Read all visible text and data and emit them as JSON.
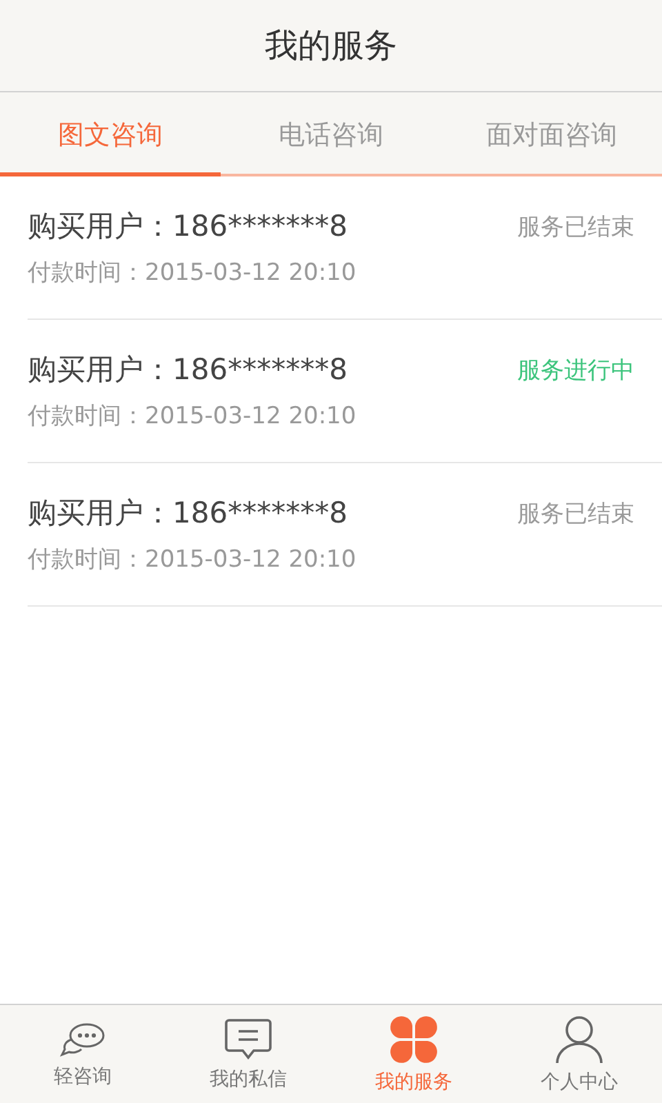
{
  "header": {
    "title": "我的服务"
  },
  "tabs": [
    {
      "label": "图文咨询",
      "selected": true
    },
    {
      "label": "电话咨询",
      "selected": false
    },
    {
      "label": "面对面咨询",
      "selected": false
    }
  ],
  "orders": [
    {
      "buyer": "购买用户：186*******8",
      "paid_time": "付款时间：2015-03-12 20:10",
      "status": "服务已结束",
      "color": "#9a9a9a"
    },
    {
      "buyer": "购买用户：186*******8",
      "paid_time": "付款时间：2015-03-12 20:10",
      "status": "服务进行中",
      "color": "#3cc47c"
    },
    {
      "buyer": "购买用户：186*******8",
      "paid_time": "付款时间：2015-03-12 20:10",
      "status": "服务已结束",
      "color": "#9a9a9a"
    }
  ],
  "bottom_nav": [
    {
      "kind": "chat",
      "label": "轻咨询",
      "selected": false
    },
    {
      "kind": "message",
      "label": "我的私信",
      "selected": false
    },
    {
      "kind": "clover",
      "label": "我的服务",
      "selected": true
    },
    {
      "kind": "person",
      "label": "个人中心",
      "selected": false
    }
  ]
}
